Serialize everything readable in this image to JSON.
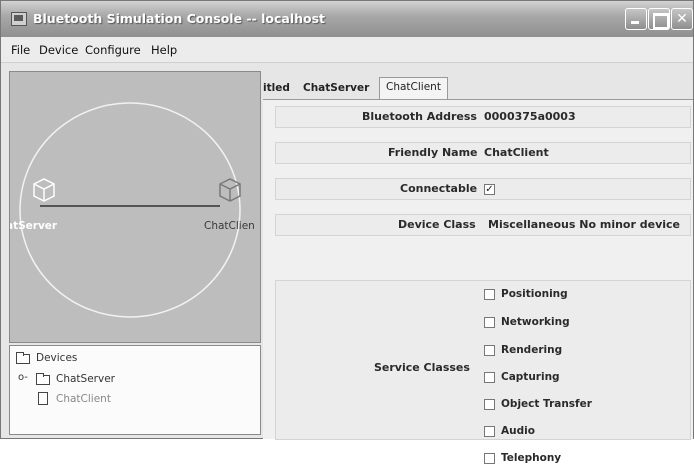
{
  "window": {
    "title": "Bluetooth Simulation Console -- localhost"
  },
  "menubar": {
    "items": [
      "File",
      "Device",
      "Configure",
      "Help"
    ]
  },
  "topology": {
    "server_label": "atServer",
    "client_label": "ChatClien"
  },
  "tree": {
    "root": "Devices",
    "expander": "o-",
    "children": [
      "ChatServer",
      "ChatClient"
    ]
  },
  "tabs": [
    "itled",
    "ChatServer",
    "ChatClient"
  ],
  "properties": {
    "bluetooth_address_label": "Bluetooth Address",
    "bluetooth_address_value": "0000375a0003",
    "friendly_name_label": "Friendly Name",
    "friendly_name_value": "ChatClient",
    "connectable_label": "Connectable",
    "connectable_checked": true,
    "connectable_mark": "✓",
    "device_class_label": "Device Class",
    "device_class_value": "Miscellaneous  No minor device",
    "service_classes_label": "Service Classes",
    "service_classes": [
      {
        "label": "Positioning",
        "checked": false
      },
      {
        "label": "Networking",
        "checked": false
      },
      {
        "label": "Rendering",
        "checked": false
      },
      {
        "label": "Capturing",
        "checked": false
      },
      {
        "label": "Object Transfer",
        "checked": false
      },
      {
        "label": "Audio",
        "checked": false
      },
      {
        "label": "Telephony",
        "checked": false
      }
    ]
  }
}
